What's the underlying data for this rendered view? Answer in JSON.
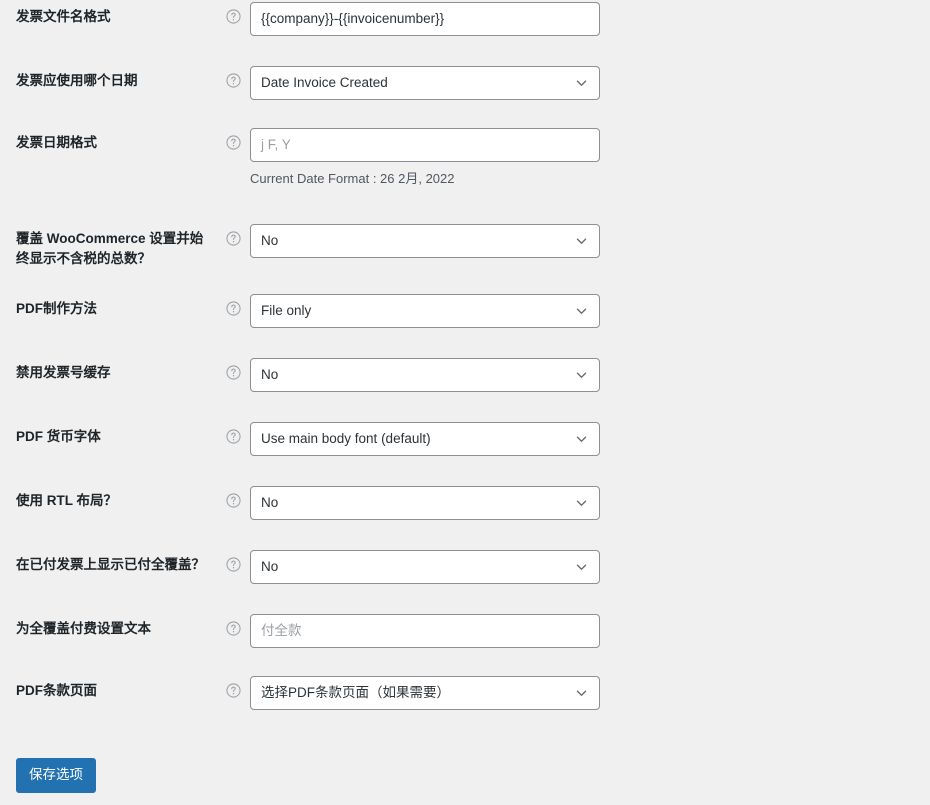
{
  "page": {
    "background_color": "#f0f0f1",
    "label_color": "#1d2327",
    "accent_color": "#2271b1"
  },
  "help_icon_name": "help-circle-icon",
  "chevron_icon_name": "chevron-down-icon",
  "rows": [
    {
      "label": "发票文件名格式",
      "control": "text",
      "value": "{{company}}-{{invoicenumber}}",
      "is_placeholder": false,
      "helper": ""
    },
    {
      "label": "发票应使用哪个日期",
      "control": "select",
      "value": "Date Invoice Created",
      "is_placeholder": false,
      "helper": ""
    },
    {
      "label": "发票日期格式",
      "control": "text",
      "value": "j F, Y",
      "is_placeholder": true,
      "helper": "Current Date Format : 26 2月, 2022"
    },
    {
      "label": "覆盖 WooCommerce 设置并始终显示不含税的总数？",
      "control": "select",
      "value": "No",
      "is_placeholder": false,
      "helper": ""
    },
    {
      "label": "PDF制作方法",
      "control": "select",
      "value": "File only",
      "is_placeholder": false,
      "helper": ""
    },
    {
      "label": "禁用发票号缓存",
      "control": "select",
      "value": "No",
      "is_placeholder": false,
      "helper": ""
    },
    {
      "label": "PDF 货币字体",
      "control": "select",
      "value": "Use main body font (default)",
      "is_placeholder": false,
      "helper": ""
    },
    {
      "label": "使用 RTL 布局？",
      "control": "select",
      "value": "No",
      "is_placeholder": false,
      "helper": ""
    },
    {
      "label": "在已付发票上显示已付全覆盖？",
      "control": "select",
      "value": "No",
      "is_placeholder": false,
      "helper": ""
    },
    {
      "label": "为全覆盖付费设置文本",
      "control": "text",
      "value": "付全款",
      "is_placeholder": true,
      "helper": ""
    },
    {
      "label": "PDF条款页面",
      "control": "select",
      "value": "选择PDF条款页面（如果需要）",
      "is_placeholder": false,
      "helper": ""
    }
  ],
  "submit": {
    "label": "保存选项"
  }
}
